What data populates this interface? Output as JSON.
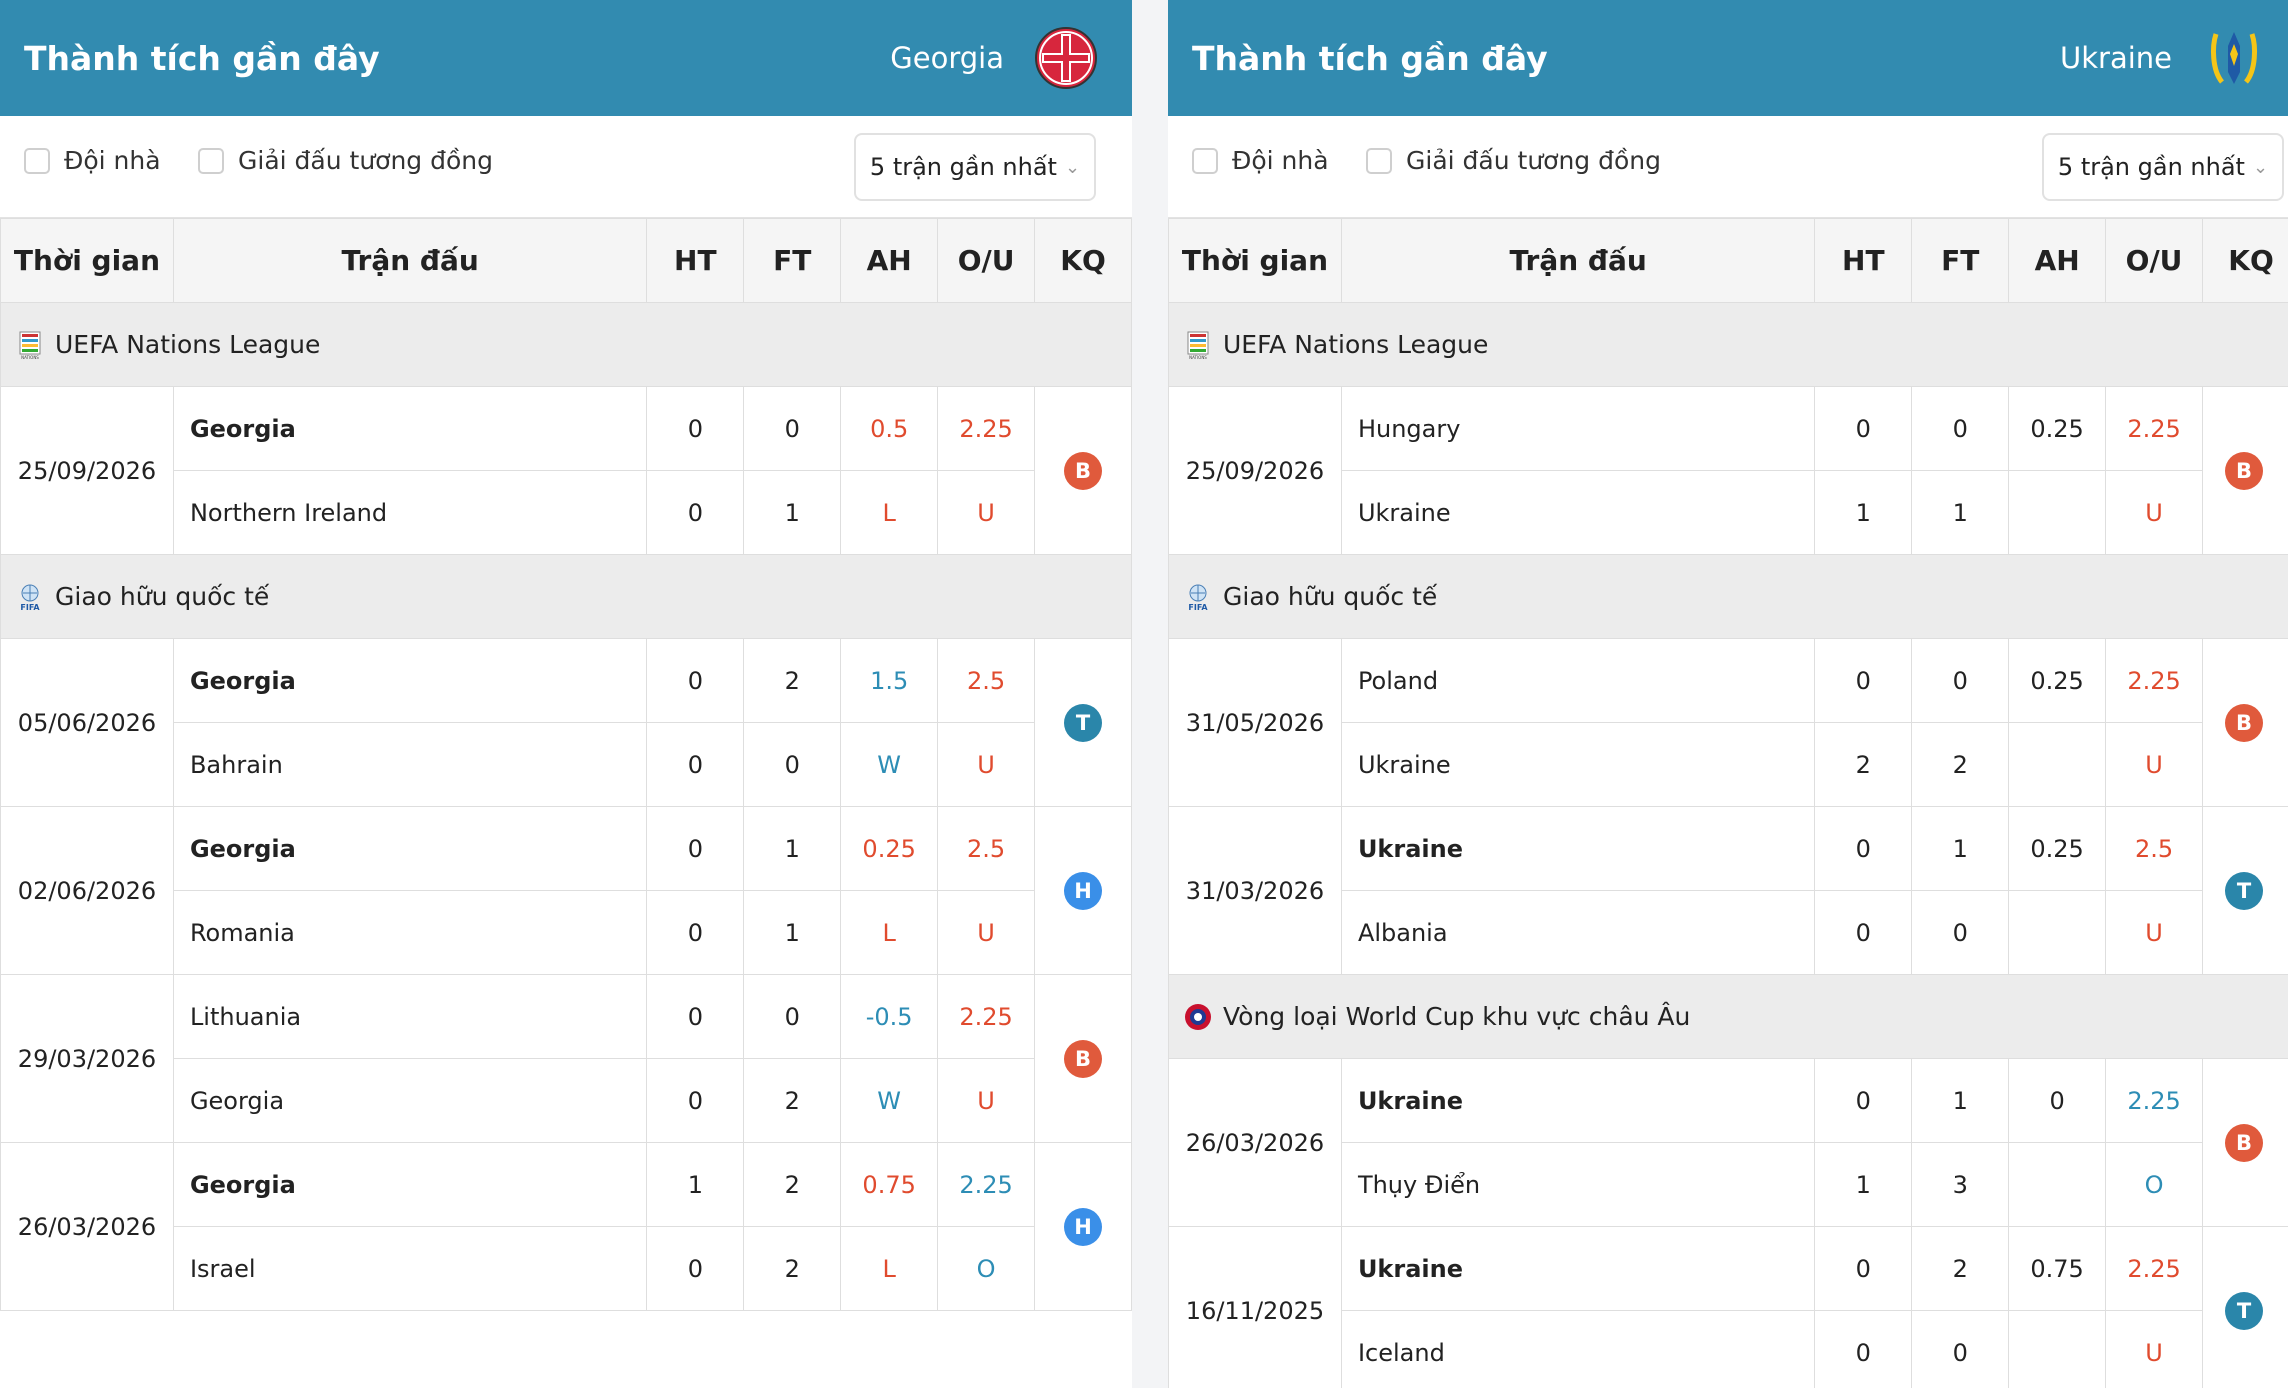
{
  "colors": {
    "header_bg": "#328bb0",
    "result_B": "#e05a3c",
    "result_T": "#2a86aa",
    "result_H": "#3a8fe8",
    "text_red": "#e04b2e",
    "text_blue": "#2d8db5"
  },
  "left": {
    "title": "Thành tích gần đây",
    "team": "Georgia",
    "team_logo_icon": "georgia-federation-logo",
    "filters": {
      "home_label": "Đội nhà",
      "same_league_label": "Giải đấu tương đồng",
      "select_value": "5 trận gần nhất"
    },
    "columns": {
      "time": "Thời gian",
      "match": "Trận đấu",
      "ht": "HT",
      "ft": "FT",
      "ah": "AH",
      "ou": "O/U",
      "kq": "KQ"
    },
    "comps": [
      {
        "name": "UEFA Nations League",
        "icon": "nations-league-icon"
      },
      {
        "name": "Giao hữu quốc tế",
        "icon": "fifa-icon"
      }
    ],
    "matches": [
      {
        "date": "25/09/2026",
        "home": "Georgia",
        "away": "Northern Ireland",
        "ht_home": "0",
        "ht_away": "0",
        "ft_home": "0",
        "ft_away": "1",
        "ah": "0.5",
        "ah_result": "L",
        "ou": "2.25",
        "ou_result": "U",
        "kq": "B"
      },
      {
        "date": "05/06/2026",
        "home": "Georgia",
        "away": "Bahrain",
        "ht_home": "0",
        "ht_away": "0",
        "ft_home": "2",
        "ft_away": "0",
        "ah": "1.5",
        "ah_result": "W",
        "ou": "2.5",
        "ou_result": "U",
        "kq": "T"
      },
      {
        "date": "02/06/2026",
        "home": "Georgia",
        "away": "Romania",
        "ht_home": "0",
        "ht_away": "0",
        "ft_home": "1",
        "ft_away": "1",
        "ah": "0.25",
        "ah_result": "L",
        "ou": "2.5",
        "ou_result": "U",
        "kq": "H"
      },
      {
        "date": "29/03/2026",
        "home": "Lithuania",
        "away": "Georgia",
        "ht_home": "0",
        "ht_away": "0",
        "ft_home": "0",
        "ft_away": "2",
        "ah": "-0.5",
        "ah_result": "W",
        "ou": "2.25",
        "ou_result": "U",
        "kq": "B"
      },
      {
        "date": "26/03/2026",
        "home": "Georgia",
        "away": "Israel",
        "ht_home": "1",
        "ht_away": "0",
        "ft_home": "2",
        "ft_away": "2",
        "ah": "0.75",
        "ah_result": "L",
        "ou": "2.25",
        "ou_result": "O",
        "kq": "H"
      }
    ]
  },
  "right": {
    "title": "Thành tích gần đây",
    "team": "Ukraine",
    "team_logo_icon": "ukraine-federation-logo",
    "filters": {
      "home_label": "Đội nhà",
      "same_league_label": "Giải đấu tương đồng",
      "select_value": "5 trận gần nhất"
    },
    "columns": {
      "time": "Thời gian",
      "match": "Trận đấu",
      "ht": "HT",
      "ft": "FT",
      "ah": "AH",
      "ou": "O/U",
      "kq": "KQ"
    },
    "comps": [
      {
        "name": "UEFA Nations League",
        "icon": "nations-league-icon"
      },
      {
        "name": "Giao hữu quốc tế",
        "icon": "fifa-icon"
      },
      {
        "name": "Vòng loại World Cup khu vực châu Âu",
        "icon": "uefa-icon"
      }
    ],
    "matches": [
      {
        "date": "25/09/2026",
        "home": "Hungary",
        "away": "Ukraine",
        "ht_home": "0",
        "ht_away": "1",
        "ft_home": "0",
        "ft_away": "1",
        "ah": "0.25",
        "ou": "2.25",
        "ou_result": "U",
        "kq": "B"
      },
      {
        "date": "31/05/2026",
        "home": "Poland",
        "away": "Ukraine",
        "ht_home": "0",
        "ht_away": "2",
        "ft_home": "0",
        "ft_away": "2",
        "ah": "0.25",
        "ou": "2.25",
        "ou_result": "U",
        "kq": "B"
      },
      {
        "date": "31/03/2026",
        "home": "Ukraine",
        "away": "Albania",
        "ht_home": "0",
        "ht_away": "0",
        "ft_home": "1",
        "ft_away": "0",
        "ah": "0.25",
        "ou": "2.5",
        "ou_result": "U",
        "kq": "T"
      },
      {
        "date": "26/03/2026",
        "home": "Ukraine",
        "away": "Thụy Điển",
        "ht_home": "0",
        "ht_away": "1",
        "ft_home": "1",
        "ft_away": "3",
        "ah": "0",
        "ou": "2.25",
        "ou_result": "O",
        "kq": "B"
      },
      {
        "date": "16/11/2025",
        "home": "Ukraine",
        "away": "Iceland",
        "ht_home": "0",
        "ht_away": "0",
        "ft_home": "2",
        "ft_away": "0",
        "ah": "0.75",
        "ou": "2.25",
        "ou_result": "U",
        "kq": "T"
      }
    ]
  }
}
